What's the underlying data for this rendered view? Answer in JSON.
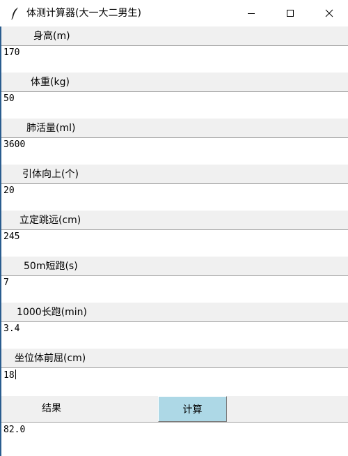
{
  "window": {
    "title": "体测计算器(大一大二男生)",
    "icon": "feather-icon"
  },
  "fields": [
    {
      "label": "身高(m)",
      "value": "170"
    },
    {
      "label": "体重(kg)",
      "value": "50"
    },
    {
      "label": "肺活量(ml)",
      "value": "3600"
    },
    {
      "label": "引体向上(个)",
      "value": "20"
    },
    {
      "label": "立定跳远(cm)",
      "value": "245"
    },
    {
      "label": "50m短跑(s)",
      "value": "7"
    },
    {
      "label": "1000长跑(min)",
      "value": "3.4"
    },
    {
      "label": "坐位体前屈(cm)",
      "value": "18"
    }
  ],
  "result": {
    "label": "结果",
    "button_label": "计算",
    "value": "82.0"
  },
  "colors": {
    "button_bg": "#add8e6",
    "label_bg": "#f0f0f0"
  }
}
